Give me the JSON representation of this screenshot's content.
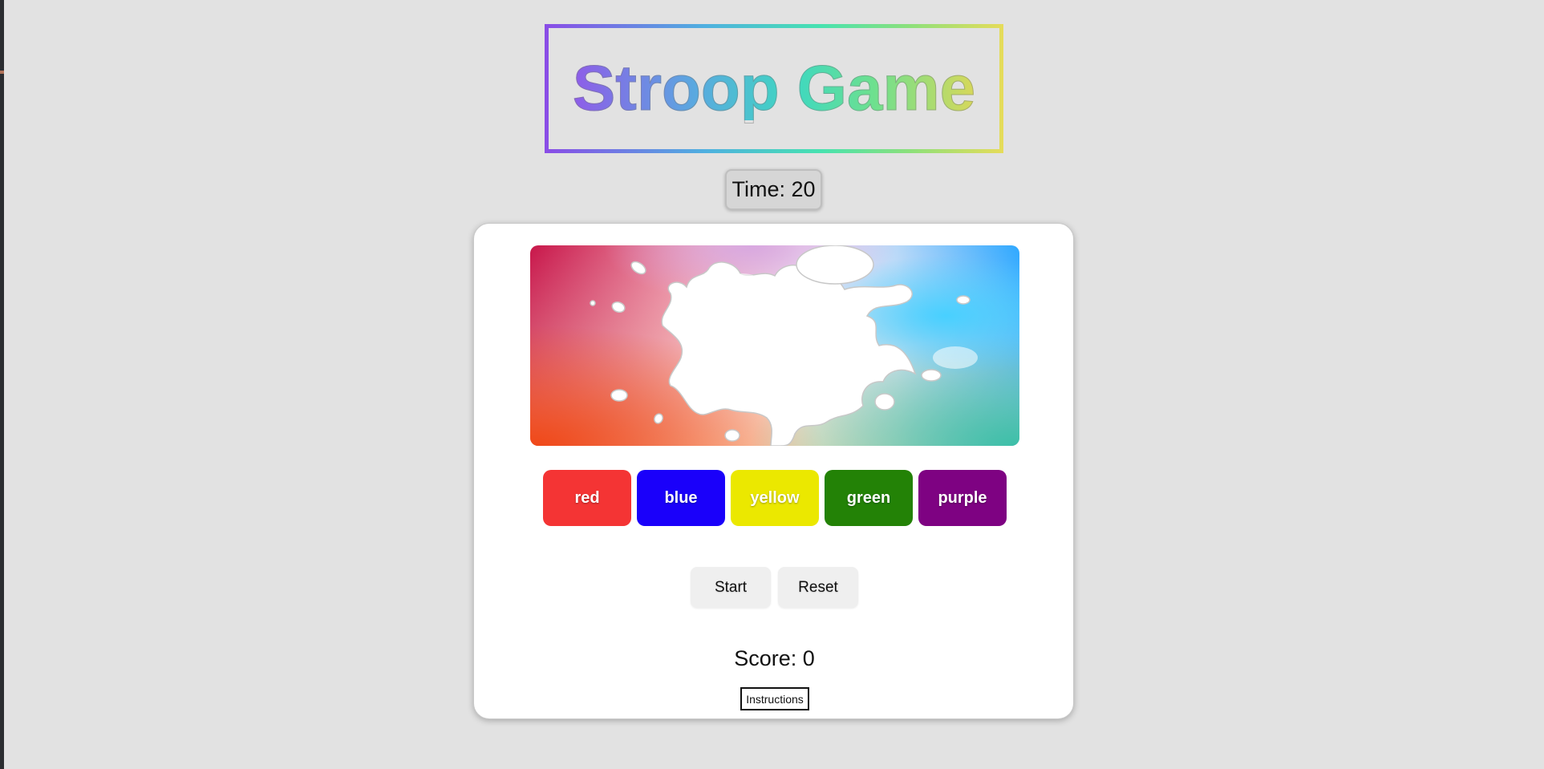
{
  "header": {
    "title": "Stroop Game"
  },
  "timer": {
    "label": "Time: 20"
  },
  "color_buttons": [
    {
      "label": "red",
      "color": "#f43434"
    },
    {
      "label": "blue",
      "color": "#1a00fa"
    },
    {
      "label": "yellow",
      "color": "#ebe800"
    },
    {
      "label": "green",
      "color": "#238206"
    },
    {
      "label": "purple",
      "color": "#7e0282"
    }
  ],
  "controls": {
    "start_label": "Start",
    "reset_label": "Reset"
  },
  "score": {
    "label": "Score: 0"
  },
  "instructions": {
    "label": "Instructions"
  },
  "splash_image": {
    "icon": "paint-splash-image"
  }
}
